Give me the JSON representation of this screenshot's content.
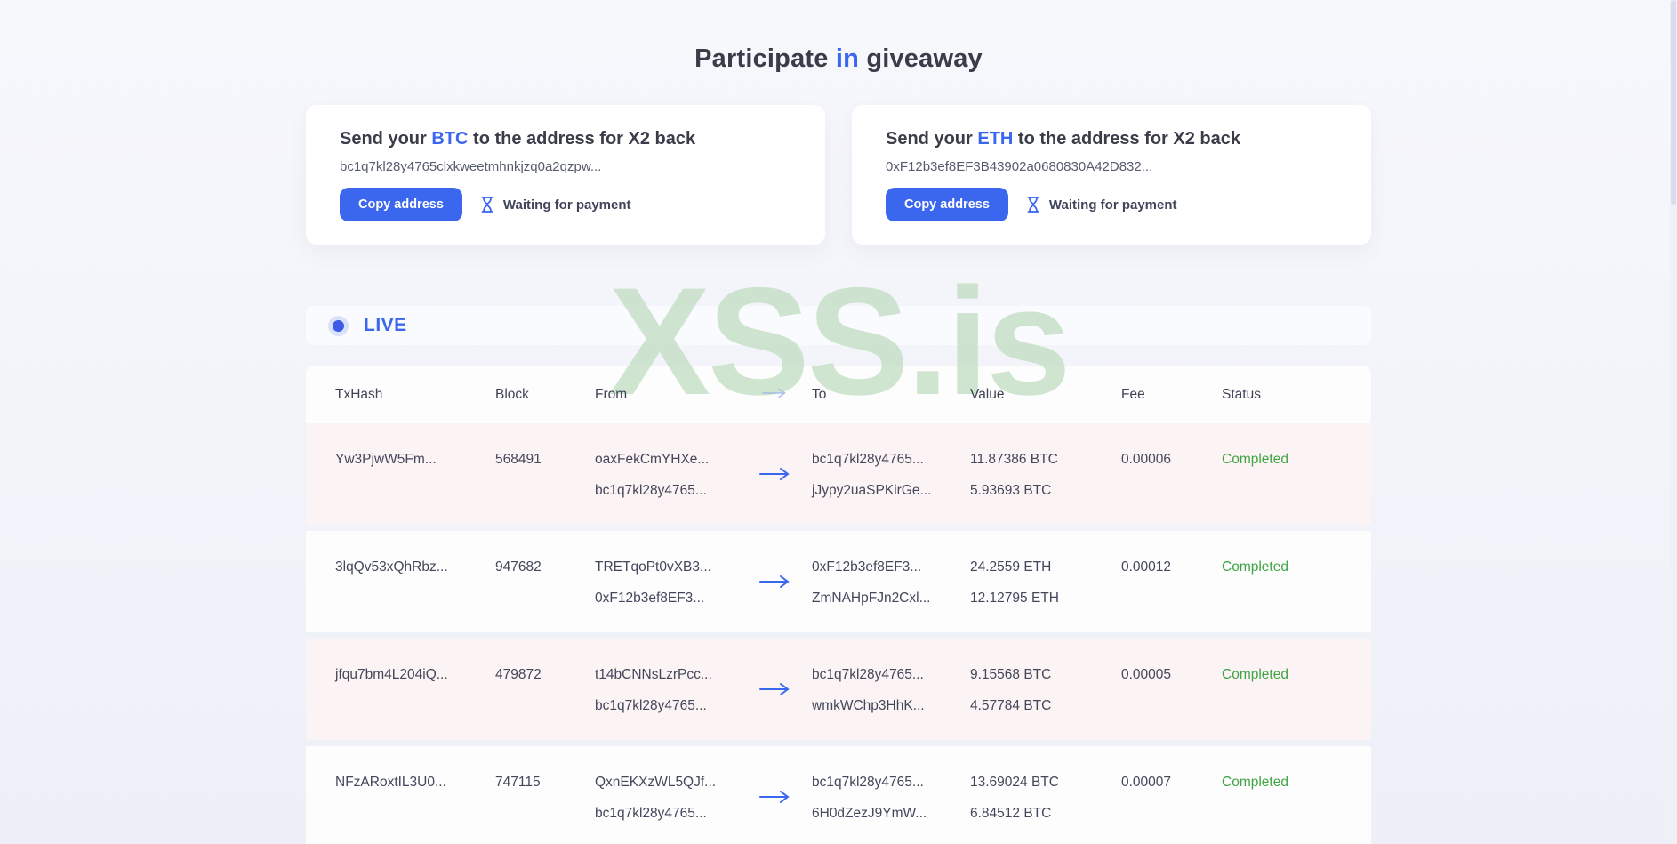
{
  "title": {
    "part1": "Participate",
    "part2": "in",
    "part3": "giveaway"
  },
  "cards": [
    {
      "heading_pre": "Send your",
      "coin": "BTC",
      "heading_post": "to the address for X2 back",
      "address": "bc1q7kl28y4765clxkweetmhnkjzq0a2qzpw...",
      "copy_button": "Copy address",
      "status": "Waiting for payment"
    },
    {
      "heading_pre": "Send your",
      "coin": "ETH",
      "heading_post": "to the address for X2 back",
      "address": "0xF12b3ef8EF3B43902a0680830A42D832...",
      "copy_button": "Copy address",
      "status": "Waiting for payment"
    }
  ],
  "live": {
    "label": "LIVE"
  },
  "watermark": "XSS.is",
  "table": {
    "headers": {
      "txhash": "TxHash",
      "block": "Block",
      "from": "From",
      "to": "To",
      "value": "Value",
      "fee": "Fee",
      "status": "Status"
    },
    "rows": [
      {
        "txhash": "Yw3PjwW5Fm...",
        "block": "568491",
        "from1": "oaxFekCmYHXe...",
        "from2": "bc1q7kl28y4765...",
        "to1": "bc1q7kl28y4765...",
        "to2": "jJypy2uaSPKirGe...",
        "value1": "11.87386 BTC",
        "value2": "5.93693 BTC",
        "fee": "0.00006",
        "status": "Completed"
      },
      {
        "txhash": "3lqQv53xQhRbz...",
        "block": "947682",
        "from1": "TRETqoPt0vXB3...",
        "from2": "0xF12b3ef8EF3...",
        "to1": "0xF12b3ef8EF3...",
        "to2": "ZmNAHpFJn2Cxl...",
        "value1": "24.2559 ETH",
        "value2": "12.12795 ETH",
        "fee": "0.00012",
        "status": "Completed"
      },
      {
        "txhash": "jfqu7bm4L204iQ...",
        "block": "479872",
        "from1": "t14bCNNsLzrPcc...",
        "from2": "bc1q7kl28y4765...",
        "to1": "bc1q7kl28y4765...",
        "to2": "wmkWChp3HhK...",
        "value1": "9.15568 BTC",
        "value2": "4.57784 BTC",
        "fee": "0.00005",
        "status": "Completed"
      },
      {
        "txhash": "NFzARoxtIL3U0...",
        "block": "747115",
        "from1": "QxnEKXzWL5QJf...",
        "from2": "bc1q7kl28y4765...",
        "to1": "bc1q7kl28y4765...",
        "to2": "6H0dZezJ9YmW...",
        "value1": "13.69024 BTC",
        "value2": "6.84512 BTC",
        "fee": "0.00007",
        "status": "Completed"
      }
    ]
  },
  "colors": {
    "accent_blue": "#3b66ee",
    "status_green": "#3fa444",
    "watermark_green": "#c8e1c8",
    "row_pink": "#fcf3f5",
    "page_background": "#eef0f8"
  }
}
